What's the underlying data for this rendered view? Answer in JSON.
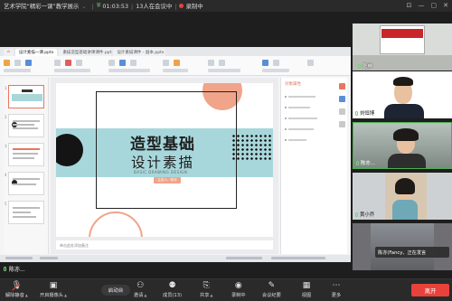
{
  "topbar": {
    "meeting_title": "艺术学院“精彩一课”教学展示",
    "duration": "01:03:53",
    "attendees": "13人在会议中",
    "recording": "录制中"
  },
  "fullscreen_label": "全屏",
  "share": {
    "tabs": [
      "设计素描一课.pptx",
      "素描造型基础讲课课件.pptx",
      "设计素描课件 - 副本.pptx"
    ],
    "slide": {
      "title_line1": "造型基础",
      "title_line2": "设计素描",
      "subtitle": "BASIC DRAWING DESIGN",
      "button": "主讲人：陈亦",
      "notes": "单击此处添加备注"
    },
    "right_pane_title": "对象属性"
  },
  "participants": [
    {
      "name": "张申",
      "mic": "on"
    },
    {
      "name": "刘恒博",
      "mic": "on"
    },
    {
      "name": "陈亦...",
      "mic": "on"
    },
    {
      "name": "黄小乔",
      "mic": "on"
    },
    {
      "name": "",
      "mic": "on"
    }
  ],
  "speaking_bubble": "陈亦(Fancy、正在发言",
  "speaker_label": "陈亦...",
  "toolbar": {
    "mute": "解除静音",
    "video": "开启摄像头",
    "share_pill": "启动台",
    "invite": "邀请",
    "members": "成员(13)",
    "share": "共享",
    "record": "录制中",
    "minutes": "会议纪要",
    "view": "视图",
    "more": "更多",
    "leave": "离开"
  },
  "colors": {
    "accent_band": "#a8d7db",
    "accent_peach": "#f0a48a",
    "leave_red": "#e8423a"
  }
}
